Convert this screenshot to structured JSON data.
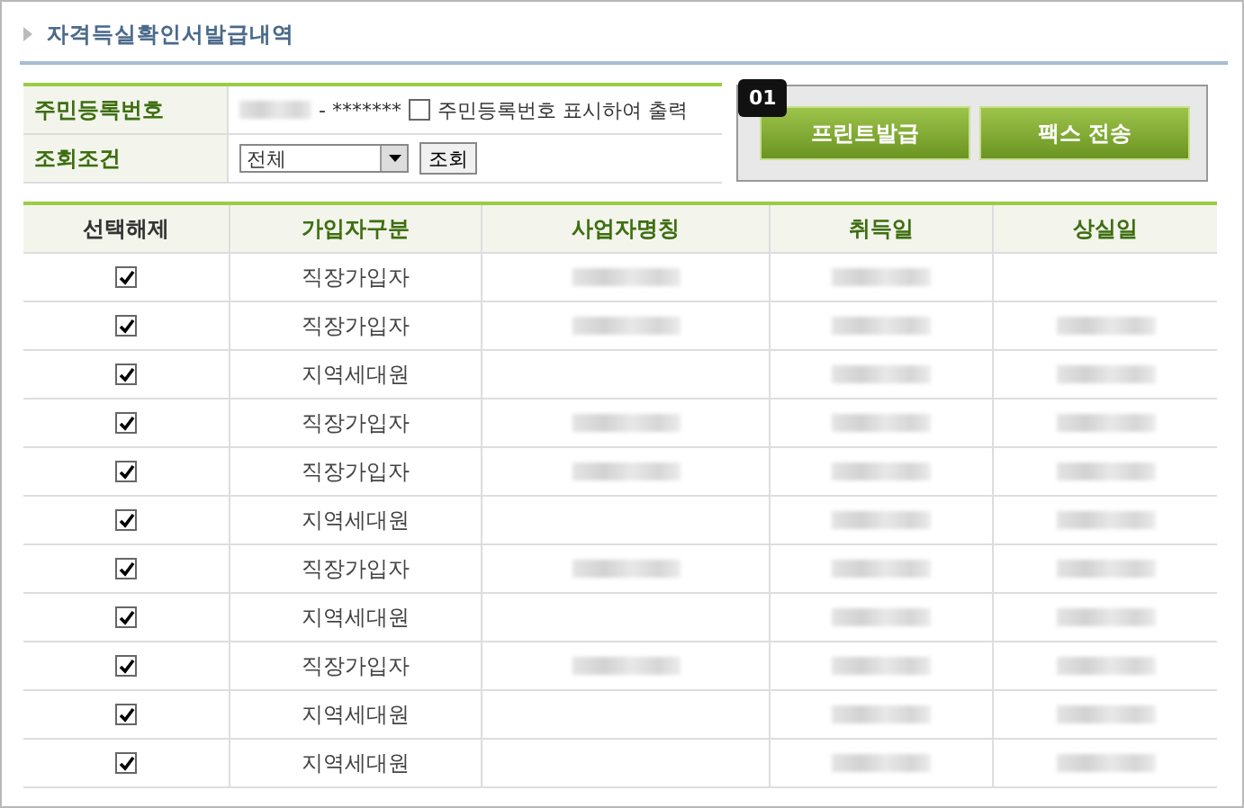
{
  "title": "자격득실확인서발급내역",
  "form": {
    "id_label": "주민등록번호",
    "id_masked": "- *******",
    "id_redacted": true,
    "show_id": {
      "label": "주민등록번호 표시하여 출력",
      "checked": false
    },
    "condition_label": "조회조건",
    "condition_value": "전체",
    "search_button": "조회"
  },
  "badge": "01",
  "buttons": [
    "프린트발급",
    "팩스 전송"
  ],
  "table": {
    "columns": [
      "선택해제",
      "가입자구분",
      "사업자명칭",
      "취득일",
      "상실일"
    ],
    "rows": [
      {
        "checked": true,
        "type": "직장가입자",
        "company_redacted": true,
        "acquired_redacted": true,
        "lost_redacted": false
      },
      {
        "checked": true,
        "type": "직장가입자",
        "company_redacted": true,
        "acquired_redacted": true,
        "lost_redacted": true
      },
      {
        "checked": true,
        "type": "지역세대원",
        "company_redacted": false,
        "acquired_redacted": true,
        "lost_redacted": true
      },
      {
        "checked": true,
        "type": "직장가입자",
        "company_redacted": true,
        "acquired_redacted": true,
        "lost_redacted": true
      },
      {
        "checked": true,
        "type": "직장가입자",
        "company_redacted": true,
        "acquired_redacted": true,
        "lost_redacted": true
      },
      {
        "checked": true,
        "type": "지역세대원",
        "company_redacted": false,
        "acquired_redacted": true,
        "lost_redacted": true
      },
      {
        "checked": true,
        "type": "직장가입자",
        "company_redacted": true,
        "acquired_redacted": true,
        "lost_redacted": true
      },
      {
        "checked": true,
        "type": "지역세대원",
        "company_redacted": false,
        "acquired_redacted": true,
        "lost_redacted": true
      },
      {
        "checked": true,
        "type": "직장가입자",
        "company_redacted": true,
        "acquired_redacted": true,
        "lost_redacted": true
      },
      {
        "checked": true,
        "type": "지역세대원",
        "company_redacted": false,
        "acquired_redacted": true,
        "lost_redacted": true
      },
      {
        "checked": true,
        "type": "지역세대원",
        "company_redacted": false,
        "acquired_redacted": true,
        "lost_redacted": true
      }
    ]
  }
}
